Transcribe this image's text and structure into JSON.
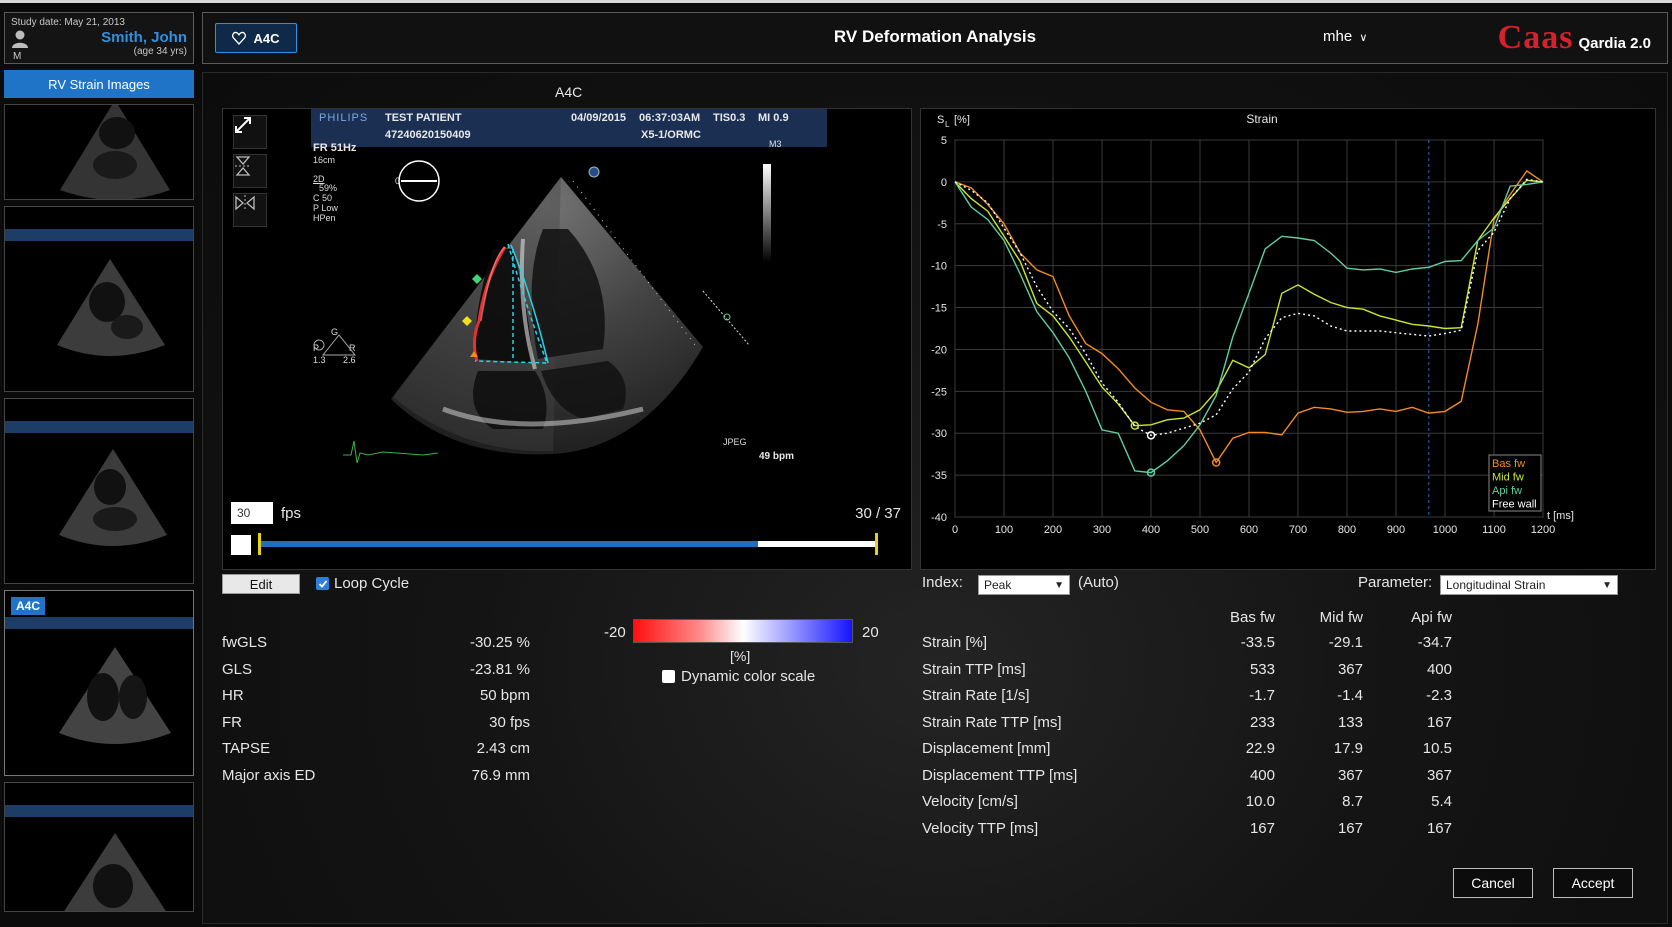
{
  "patient": {
    "study_date": "Study date: May 21, 2013",
    "name": "Smith, John",
    "age": "(age 34 yrs)",
    "sex": "M"
  },
  "header": {
    "view_chip": "A4C",
    "title": "RV Deformation Analysis",
    "user": "mhe",
    "brand_name": "Caas",
    "brand_product": "Qardia 2.0"
  },
  "sidebar": {
    "button": "RV Strain Images",
    "active_chip": "A4C"
  },
  "viewer": {
    "view_label": "A4C",
    "overlay": {
      "vendor": "PHILIPS",
      "patient": "TEST PATIENT",
      "patient_id": "47240620150409",
      "date": "04/09/2015",
      "time": "06:37:03AM",
      "tis": "TIS0.3",
      "mi": "MI 0.9",
      "probe": "X5-1/ORMC",
      "fr": "FR 51Hz",
      "depth": "16cm",
      "mode": "2D",
      "gain": "59%",
      "compress": "C 50",
      "power": "P Low",
      "res": "HPen",
      "m3": "M3",
      "zero": "0",
      "jpeg": "JPEG",
      "bpm": "49 bpm",
      "g": "G",
      "r": "R",
      "p": "P",
      "v1": "1.3",
      "v2": "2.6"
    },
    "fps_value": "30",
    "fps_label": "fps",
    "frame_counter": "30 / 37",
    "timeline_position": 0.807
  },
  "controls": {
    "edit": "Edit",
    "loop_cycle": "Loop Cycle",
    "loop_checked": true
  },
  "metrics": [
    {
      "label": "fwGLS",
      "value": "-30.25 %"
    },
    {
      "label": "GLS",
      "value": "-23.81 %"
    },
    {
      "label": "HR",
      "value": "50 bpm"
    },
    {
      "label": "FR",
      "value": "30 fps"
    },
    {
      "label": "TAPSE",
      "value": "2.43 cm"
    },
    {
      "label": "Major axis ED",
      "value": "76.9 mm"
    }
  ],
  "color_scale": {
    "min": "-20",
    "max": "20",
    "unit": "[%]",
    "dynamic_label": "Dynamic color scale",
    "dynamic_checked": false
  },
  "index": {
    "label": "Index:",
    "value": "Peak",
    "suffix": "(Auto)"
  },
  "parameter": {
    "label": "Parameter:",
    "value": "Longitudinal Strain"
  },
  "results": {
    "columns": [
      "Bas fw",
      "Mid fw",
      "Api fw"
    ],
    "rows": [
      {
        "label": "Strain [%]",
        "values": [
          "-33.5",
          "-29.1",
          "-34.7"
        ]
      },
      {
        "label": "Strain TTP [ms]",
        "values": [
          "533",
          "367",
          "400"
        ]
      },
      {
        "label": "Strain Rate [1/s]",
        "values": [
          "-1.7",
          "-1.4",
          "-2.3"
        ]
      },
      {
        "label": "Strain Rate TTP [ms]",
        "values": [
          "233",
          "133",
          "167"
        ]
      },
      {
        "label": "Displacement [mm]",
        "values": [
          "22.9",
          "17.9",
          "10.5"
        ]
      },
      {
        "label": "Displacement TTP [ms]",
        "values": [
          "400",
          "367",
          "367"
        ]
      },
      {
        "label": "Velocity [cm/s]",
        "values": [
          "10.0",
          "8.7",
          "5.4"
        ]
      },
      {
        "label": "Velocity TTP [ms]",
        "values": [
          "167",
          "167",
          "167"
        ]
      }
    ]
  },
  "buttons": {
    "cancel": "Cancel",
    "accept": "Accept"
  },
  "colors": {
    "bas": "#f28c1e",
    "mid": "#c8e62a",
    "api": "#5fcf9f",
    "free": "#ffffff",
    "accent": "#1f74c8",
    "brand": "#d4212b"
  },
  "chart_data": {
    "type": "line",
    "title": "Strain",
    "ylabel": "S",
    "ylabel_sub": "L",
    "ylabel_unit": "[%]",
    "xlabel": "t [ms]",
    "xlim": [
      0,
      1200
    ],
    "ylim": [
      -40,
      5
    ],
    "xticks": [
      0,
      100,
      200,
      300,
      400,
      500,
      600,
      700,
      800,
      900,
      1000,
      1100,
      1200
    ],
    "yticks": [
      5,
      0,
      -5,
      -10,
      -15,
      -20,
      -25,
      -30,
      -35,
      -40
    ],
    "grid": true,
    "legend_position": "bottom-right",
    "marker_time": 967,
    "series": [
      {
        "name": "Bas fw",
        "color": "#f28c1e",
        "dashed": false,
        "x": [
          0,
          33,
          67,
          100,
          133,
          167,
          200,
          233,
          267,
          300,
          333,
          367,
          400,
          433,
          467,
          500,
          533,
          567,
          600,
          633,
          667,
          700,
          733,
          767,
          800,
          833,
          867,
          900,
          933,
          967,
          1000,
          1033,
          1067,
          1100,
          1133,
          1167,
          1200
        ],
        "y": [
          0,
          -0.7,
          -2.7,
          -5,
          -8.5,
          -10.5,
          -11.3,
          -16,
          -19.3,
          -20.5,
          -22.3,
          -24.6,
          -26.3,
          -27.2,
          -27.4,
          -29.6,
          -33.5,
          -30.6,
          -29.9,
          -29.9,
          -30.2,
          -27.6,
          -26.9,
          -27.1,
          -27.5,
          -27.4,
          -27.1,
          -27.4,
          -26.9,
          -27.6,
          -27.4,
          -26.2,
          -17,
          -4.5,
          -1.5,
          1.3,
          0
        ]
      },
      {
        "name": "Mid fw",
        "color": "#c8e62a",
        "dashed": false,
        "x": [
          0,
          33,
          67,
          100,
          133,
          167,
          200,
          233,
          267,
          300,
          333,
          367,
          400,
          433,
          467,
          500,
          533,
          567,
          600,
          633,
          667,
          700,
          733,
          767,
          800,
          833,
          867,
          900,
          933,
          967,
          1000,
          1033,
          1067,
          1100,
          1133,
          1167,
          1200
        ],
        "y": [
          0,
          -2,
          -3.5,
          -6.5,
          -9.5,
          -14.5,
          -16,
          -18.5,
          -21.5,
          -24.5,
          -26.5,
          -29.1,
          -29,
          -28.4,
          -28.2,
          -27.2,
          -25,
          -21.3,
          -22.2,
          -20.6,
          -13.3,
          -12.3,
          -13.4,
          -14.4,
          -15,
          -15.2,
          -16,
          -16.5,
          -17,
          -17.2,
          -17.5,
          -17.4,
          -7,
          -4.3,
          -2,
          0.2,
          0
        ]
      },
      {
        "name": "Api fw",
        "color": "#5fcf9f",
        "dashed": false,
        "x": [
          0,
          33,
          67,
          100,
          133,
          167,
          200,
          233,
          267,
          300,
          333,
          367,
          400,
          433,
          467,
          500,
          533,
          567,
          600,
          633,
          667,
          700,
          733,
          767,
          800,
          833,
          867,
          900,
          933,
          967,
          1000,
          1033,
          1067,
          1100,
          1133,
          1167,
          1200
        ],
        "y": [
          0,
          -3,
          -4.5,
          -7,
          -11,
          -15.5,
          -18,
          -21,
          -25,
          -29.6,
          -30,
          -34.5,
          -34.7,
          -33.3,
          -31.5,
          -29,
          -25.5,
          -18.5,
          -13.3,
          -8,
          -6.5,
          -6.7,
          -7,
          -8.5,
          -10.3,
          -10.5,
          -10.4,
          -10.8,
          -10.4,
          -10.2,
          -9.5,
          -9.4,
          -7,
          -5.5,
          -0.5,
          -0.3,
          0
        ]
      },
      {
        "name": "Free wall",
        "color": "#ffffff",
        "dashed": true,
        "x": [
          0,
          33,
          67,
          100,
          133,
          167,
          200,
          233,
          267,
          300,
          333,
          367,
          400,
          433,
          467,
          500,
          533,
          567,
          600,
          633,
          667,
          700,
          733,
          767,
          800,
          833,
          867,
          900,
          933,
          967,
          1000,
          1033,
          1067,
          1100,
          1133,
          1167,
          1200
        ],
        "y": [
          0,
          -1,
          -2.5,
          -5.5,
          -8.5,
          -12.5,
          -15.5,
          -17.5,
          -20.5,
          -24,
          -26.3,
          -29.2,
          -30.25,
          -30,
          -29.4,
          -28.8,
          -27.8,
          -24.7,
          -22.7,
          -18.7,
          -16.2,
          -15.7,
          -16,
          -17.2,
          -17.8,
          -17.8,
          -17.8,
          -18,
          -18.2,
          -18.4,
          -18.1,
          -17.7,
          -8.2,
          -6,
          -2,
          0.3,
          0
        ]
      }
    ],
    "markers": [
      {
        "series": "Bas fw",
        "x": 533,
        "y": -33.5
      },
      {
        "series": "Mid fw",
        "x": 367,
        "y": -29.1
      },
      {
        "series": "Api fw",
        "x": 400,
        "y": -34.7
      },
      {
        "series": "Free wall",
        "x": 400,
        "y": -30.25
      }
    ]
  }
}
